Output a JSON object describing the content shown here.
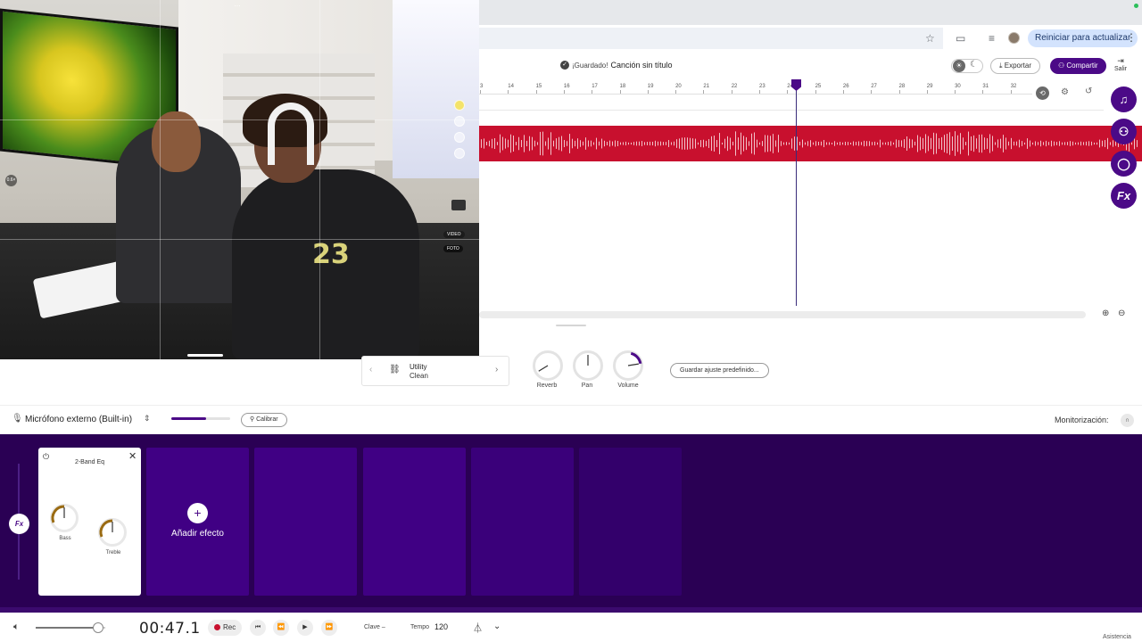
{
  "video": {
    "menu_dots": "…",
    "zoom_badge": "0.6×",
    "mode_video": "VIDEO",
    "mode_photo": "FOTO",
    "shirt_number": "23"
  },
  "browser": {
    "restart_label": "Reiniciar para actualizar",
    "kebab": "⋮"
  },
  "header": {
    "saved_label": "¡Guardado!",
    "song_title": "Canción sin título",
    "export_label": "Exportar",
    "share_label": "Compartir",
    "exit_label": "Salir"
  },
  "timeline": {
    "ruler_ticks": [
      "3",
      "14",
      "15",
      "16",
      "17",
      "18",
      "19",
      "20",
      "21",
      "22",
      "23",
      "24",
      "25",
      "26",
      "27",
      "28",
      "29",
      "30",
      "31",
      "32"
    ],
    "track_color": "#c8102e",
    "playhead_bar": 24.4
  },
  "track_controls": {
    "preset_name": "Utility",
    "preset_sub": "Clean",
    "knobs": [
      {
        "label": "Reverb",
        "value": 0.05
      },
      {
        "label": "Pan",
        "value": 0.5
      },
      {
        "label": "Volume",
        "value": 0.8
      }
    ],
    "save_preset_label": "Guardar ajuste predefinido..."
  },
  "input": {
    "mic_name": "Micrófono externo (Built-in)",
    "level": 0.59,
    "calibrate_label": "Calibrar",
    "monitor_label": "Monitorización:"
  },
  "fx": {
    "badge": "Fx",
    "eq_title": "2-Band Eq",
    "eq_knobs": [
      {
        "label": "Bass"
      },
      {
        "label": "Treble"
      }
    ],
    "add_label": "Añadir efecto",
    "accent_color": "#4b0a87"
  },
  "transport": {
    "time": "00:47.1",
    "rec_label": "Rec",
    "key_label": "Clave –",
    "tempo_label": "Tempo",
    "tempo_value": "120",
    "volume": 0.9
  },
  "footer": {
    "help_label": "Asistencia"
  }
}
